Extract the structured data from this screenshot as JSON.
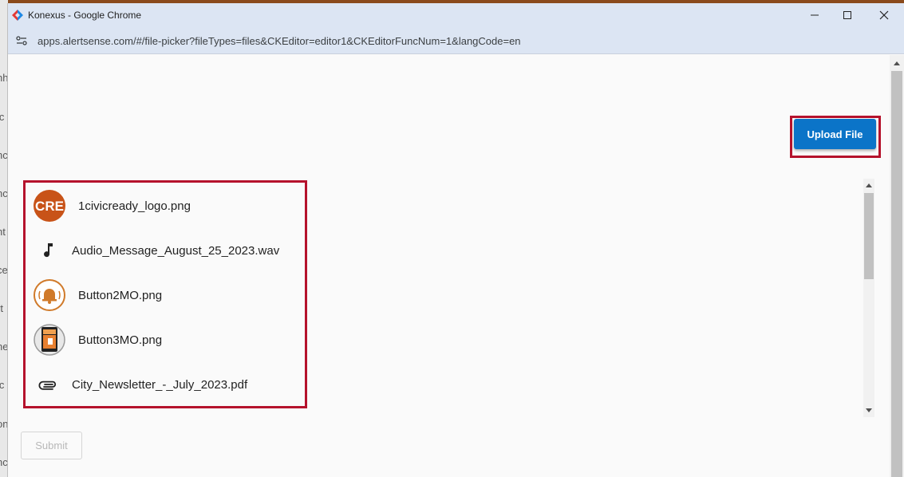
{
  "window": {
    "title": "Konexus - Google Chrome",
    "url": "apps.alertsense.com/#/file-picker?fileTypes=files&CKEditor=editor1&CKEditorFuncNum=1&langCode=en"
  },
  "background_fragments": [
    "nh",
    "ic",
    "nc",
    "nc",
    "nt",
    "ce",
    "rt",
    "ne",
    "ic",
    "on",
    "nc"
  ],
  "upload_button_label": "Upload File",
  "files": [
    {
      "name": "1civicready_logo.png",
      "icon": "civicready-logo-thumbnail"
    },
    {
      "name": "Audio_Message_August_25_2023.wav",
      "icon": "music-note-icon"
    },
    {
      "name": "Button2MO.png",
      "icon": "bell-button-thumbnail"
    },
    {
      "name": "Button3MO.png",
      "icon": "phone-button-thumbnail"
    },
    {
      "name": "City_Newsletter_-_July_2023.pdf",
      "icon": "paperclip-icon"
    }
  ],
  "submit_button_label": "Submit",
  "colors": {
    "accent": "#0b74c8",
    "highlight_outline": "#b5122c",
    "titlebar": "#dce5f3",
    "logo_orange": "#c85318"
  }
}
